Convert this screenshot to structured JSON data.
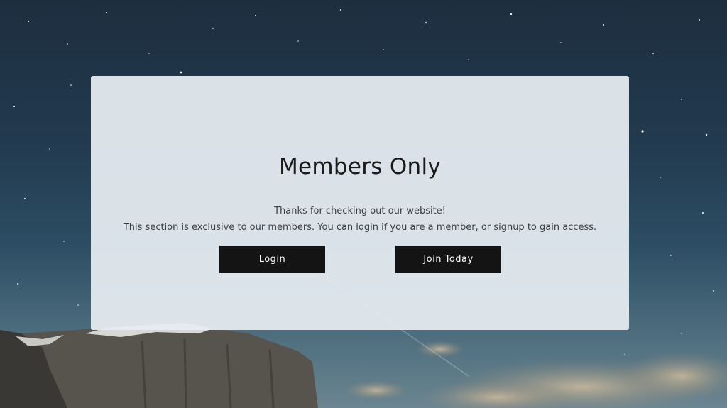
{
  "members_panel": {
    "title": "Members Only",
    "message_line1": "Thanks for checking out our website!",
    "message_line2": "This section is exclusive to our members. You can login if you are a member, or signup to gain access.",
    "login_label": "Login",
    "join_label": "Join Today"
  },
  "colors": {
    "button_background": "#141414",
    "button_text": "#ffffff",
    "panel_background": "#e6ecf1",
    "title_text": "#1a1a1a"
  }
}
